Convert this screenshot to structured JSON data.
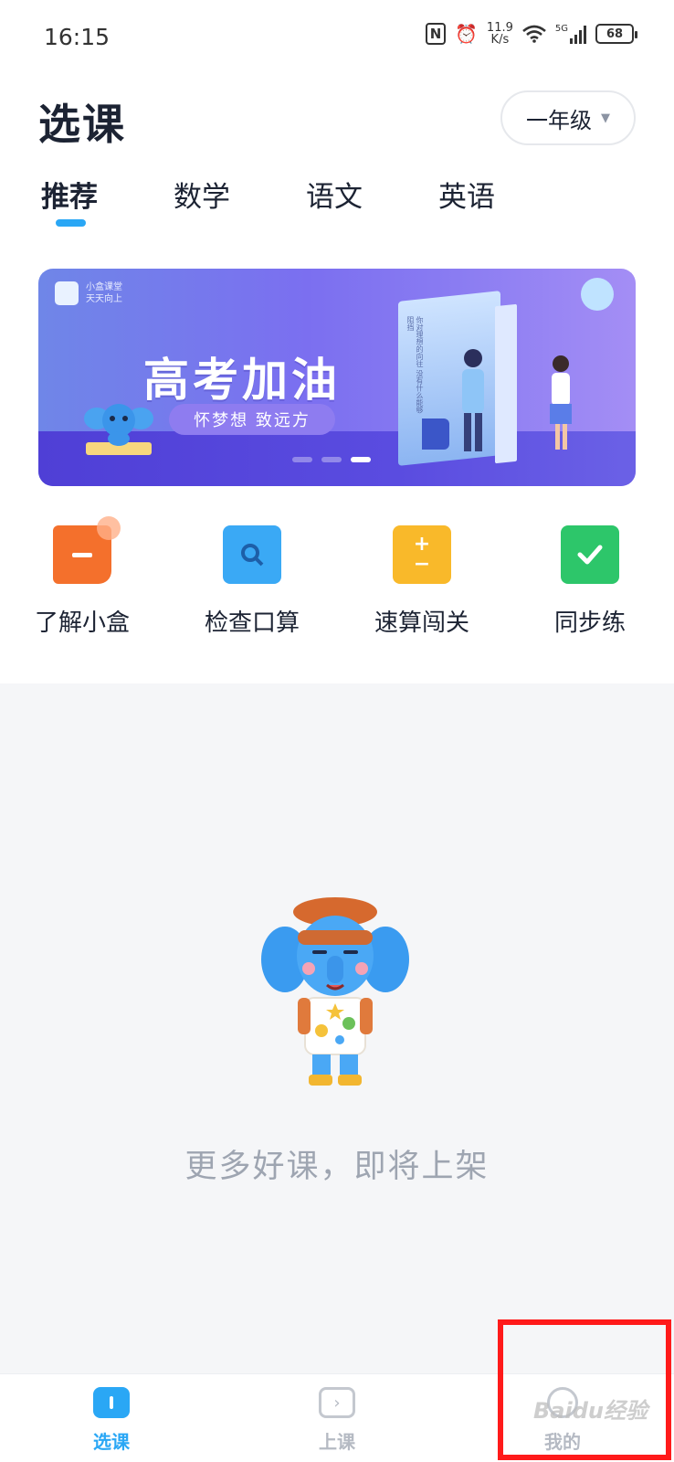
{
  "status_bar": {
    "time": "16:15",
    "nfc": "N",
    "speed_value": "11.9",
    "speed_unit": "K/s",
    "network": "5G",
    "battery": "68"
  },
  "header": {
    "title": "选课",
    "grade": "一年级"
  },
  "tabs": [
    {
      "label": "推荐",
      "active": true
    },
    {
      "label": "数学",
      "active": false
    },
    {
      "label": "语文",
      "active": false
    },
    {
      "label": "英语",
      "active": false
    }
  ],
  "banner": {
    "logo_text": [
      "小盒课堂",
      "天天向上"
    ],
    "title": "高考加油",
    "subtitle": "怀梦想 致远方",
    "book_text": "你对理想的向往 没有什么能够阻挡",
    "slide_count": 3,
    "active_slide": 3
  },
  "shortcuts": [
    {
      "label": "了解小盒",
      "icon": "info-flag-icon",
      "color": "#f4702c"
    },
    {
      "label": "检查口算",
      "icon": "search-check-icon",
      "color": "#3aa9f5"
    },
    {
      "label": "速算闯关",
      "icon": "calculator-icon",
      "color": "#f9b92a"
    },
    {
      "label": "同步练",
      "icon": "checkmark-book-icon",
      "color": "#2dc66a"
    }
  ],
  "empty_state": {
    "message": "更多好课，即将上架"
  },
  "bottom_nav": [
    {
      "label": "选课",
      "icon": "book-icon",
      "active": true,
      "color": "#2aa7f5"
    },
    {
      "label": "上课",
      "icon": "play-icon",
      "active": false,
      "color": "#b5bac3"
    },
    {
      "label": "我的",
      "icon": "user-icon",
      "active": false,
      "color": "#b5bac3"
    }
  ],
  "watermark": "Baidu经验",
  "colors": {
    "accent": "#2aa7f5",
    "highlight": "#ff1a1a"
  }
}
